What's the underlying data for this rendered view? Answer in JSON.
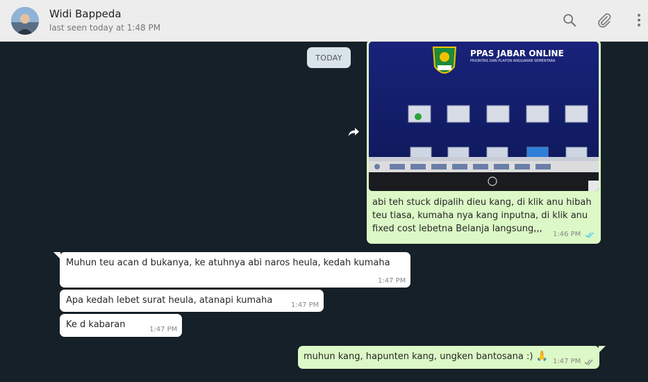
{
  "contact": {
    "name": "Widi Bappeda",
    "status": "last seen today at 1:48 PM"
  },
  "header_icons": [
    "search-icon",
    "paperclip-icon",
    "more-vert-icon"
  ],
  "day_chip": "TODAY",
  "messages": [
    {
      "direction": "outgoing",
      "type": "image",
      "image_title": "PPAS JABAR ONLINE",
      "image_subtitle": "PRIORITAS DAN PLAFON ANGGARAN SEMENTARA",
      "text": "abi teh stuck dipalih dieu kang, di klik anu hibah teu tiasa, kumaha nya kang inputna, di klik anu fixed cost lebetna Belanja langsung,,,",
      "time": "1:46 PM",
      "status": "read"
    },
    {
      "direction": "incoming",
      "text": "Muhun teu acan d bukanya, ke atuhnya abi naros heula, kedah kumaha",
      "time": "1:47 PM"
    },
    {
      "direction": "incoming",
      "text": "Apa kedah lebet surat heula, atanapi kumaha",
      "time": "1:47 PM"
    },
    {
      "direction": "incoming",
      "text": "Ke d kabaran",
      "time": "1:47 PM"
    },
    {
      "direction": "outgoing",
      "text": "muhun kang, hapunten kang, ungken bantosana :)",
      "emoji": "🙏",
      "time": "1:47 PM",
      "status": "read"
    }
  ],
  "colors": {
    "outgoing_bubble": "#dcf8c6",
    "incoming_bubble": "#ffffff",
    "chat_bg": "#162028",
    "read_ticks": "#4fc3f7",
    "delivered_ticks": "#8a8a8a"
  }
}
